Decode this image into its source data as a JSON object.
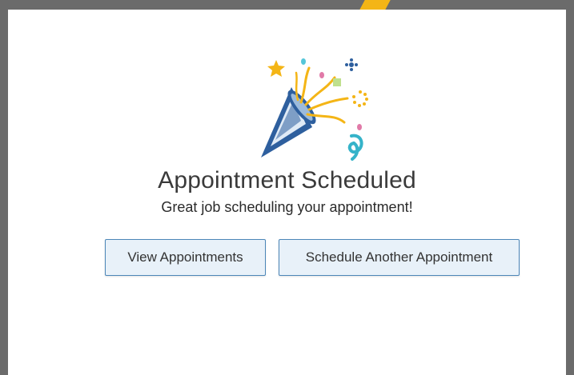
{
  "confirmation": {
    "title": "Appointment Scheduled",
    "subtitle": "Great job scheduling your appointment!",
    "illustration_icon": "party-popper-icon"
  },
  "actions": {
    "view_label": "View Appointments",
    "schedule_another_label": "Schedule Another Appointment"
  },
  "colors": {
    "background": "#6b6b6b",
    "panel": "#ffffff",
    "accent": "#f4b516",
    "button_border": "#4c86b8",
    "button_fill": "#e8f1f9",
    "popper_blue": "#2e5f9e",
    "popper_light": "#dfeaf6"
  }
}
